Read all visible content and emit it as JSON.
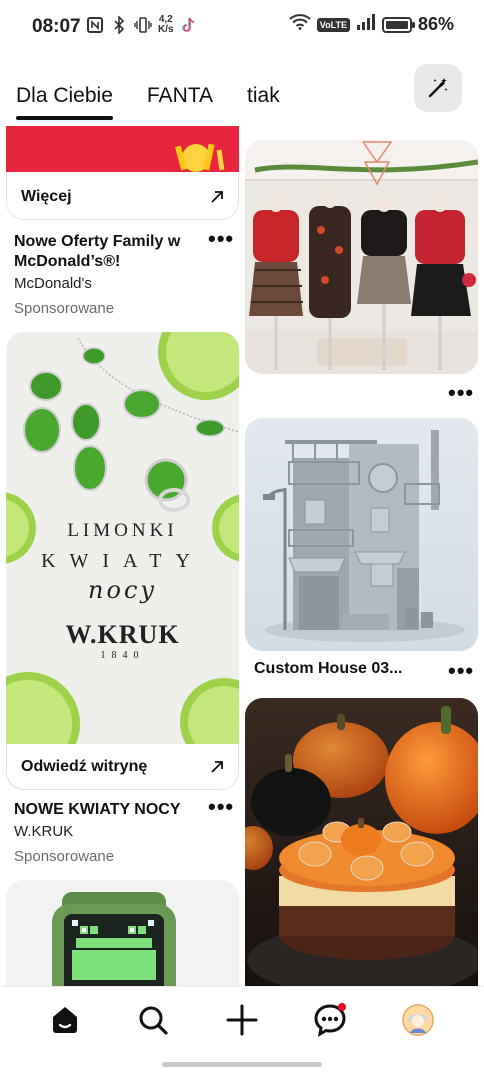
{
  "status_bar": {
    "time": "08:07",
    "speed_top": "4,2",
    "speed_bottom": "K/s",
    "network": "VoLTE",
    "battery": "86%",
    "battery_level": 0.86
  },
  "tabs": [
    {
      "label": "Dla Ciebie",
      "active": true
    },
    {
      "label": "FANTA",
      "active": false
    },
    {
      "label": "tiak",
      "active": false
    }
  ],
  "pins": {
    "mcdonalds": {
      "button_label": "Więcej",
      "title_line1": "Nowe Oferty Family w",
      "title_line2": "McDonald’s®!",
      "brand": "McDonald's",
      "sponsored": "Sponsorowane"
    },
    "wkruk": {
      "ad_line1": "LIMONKI",
      "ad_line2": "KWIATY",
      "ad_line3": "nocy",
      "logo": "W.KRUK",
      "logo_year": "1840",
      "button_label": "Odwiedź witrynę",
      "title": "NOWE KWIATY NOCY",
      "brand": "W.KRUK",
      "sponsored": "Sponsorowane"
    },
    "custom_house": {
      "title": "Custom House 03..."
    }
  },
  "colors": {
    "accent_red": "#e60023",
    "mcd_red": "#e8253f"
  }
}
